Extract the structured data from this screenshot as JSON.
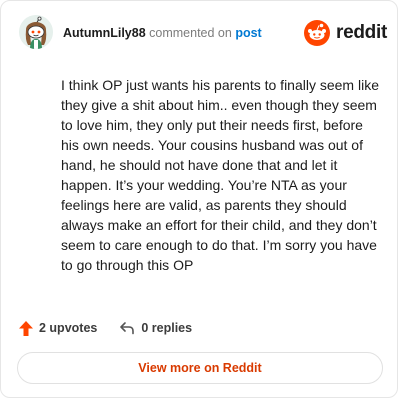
{
  "comment": {
    "author": "AutumnLily88",
    "action": "commented on",
    "post_link": "post",
    "body": "I think OP just wants his parents to finally seem like they give a shit about him.. even though they seem to love him, they only put their needs first, before his own needs. Your cousins husband was out of hand, he should not have done that and let it happen. It’s your wedding. You’re NTA as your feelings here are valid, as parents they should always make an effort for their child, and they don’t seem to care enough to do that. I’m sorry you have to go through this OP"
  },
  "brand": {
    "wordmark": "reddit",
    "icon": "reddit-snoo-icon",
    "color": "#ff4500"
  },
  "stats": {
    "upvotes": "2 upvotes",
    "replies": "0 replies",
    "upvote_icon": "upvote-arrow-icon",
    "reply_icon": "reply-arrow-icon",
    "upvote_color": "#ff4500"
  },
  "cta": {
    "label": "View more on Reddit",
    "color": "#d93a00"
  },
  "avatar": {
    "icon": "avatar-snoo-icon"
  },
  "colors": {
    "link": "#0079d3",
    "text": "#1c1c1c",
    "muted": "#7c7c7c"
  }
}
